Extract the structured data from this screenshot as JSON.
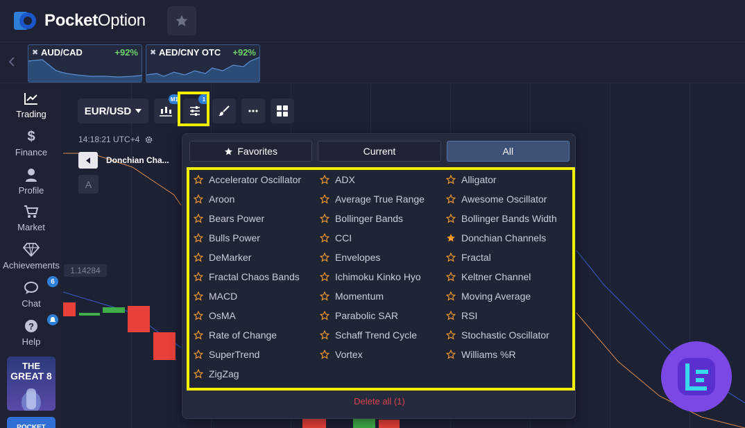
{
  "app": {
    "logo_bold": "Pocket",
    "logo_light": "Option"
  },
  "asset_tabs": [
    {
      "name": "AUD/CAD",
      "payout": "+92%"
    },
    {
      "name": "AED/CNY OTC",
      "payout": "+92%"
    }
  ],
  "sidebar": {
    "items": [
      {
        "label": "Trading",
        "icon": "chart-line-icon"
      },
      {
        "label": "Finance",
        "icon": "dollar-icon"
      },
      {
        "label": "Profile",
        "icon": "user-icon"
      },
      {
        "label": "Market",
        "icon": "cart-icon"
      },
      {
        "label": "Achievements",
        "icon": "diamond-icon"
      },
      {
        "label": "Chat",
        "icon": "chat-icon",
        "badge": "6"
      },
      {
        "label": "Help",
        "icon": "help-icon"
      }
    ],
    "promo": {
      "line1": "THE",
      "line2": "GREAT 8"
    },
    "promo2": "POCKET"
  },
  "toolbar": {
    "pair": "EUR/USD",
    "chart_type_badge": "M1",
    "indicators_badge": "1"
  },
  "chart": {
    "time": "14:18:21 UTC+4",
    "indicator_name": "Donchian Cha...",
    "a_label": "A",
    "price": "1.14284"
  },
  "panel": {
    "tabs": [
      {
        "label": "Favorites",
        "active": false
      },
      {
        "label": "Current",
        "active": false
      },
      {
        "label": "All",
        "active": true
      }
    ],
    "indicators": [
      {
        "name": "Accelerator Oscillator",
        "fav": false
      },
      {
        "name": "ADX",
        "fav": false
      },
      {
        "name": "Alligator",
        "fav": false
      },
      {
        "name": "Aroon",
        "fav": false
      },
      {
        "name": "Average True Range",
        "fav": false
      },
      {
        "name": "Awesome Oscillator",
        "fav": false
      },
      {
        "name": "Bears Power",
        "fav": false
      },
      {
        "name": "Bollinger Bands",
        "fav": false
      },
      {
        "name": "Bollinger Bands Width",
        "fav": false
      },
      {
        "name": "Bulls Power",
        "fav": false
      },
      {
        "name": "CCI",
        "fav": false
      },
      {
        "name": "Donchian Channels",
        "fav": true
      },
      {
        "name": "DeMarker",
        "fav": false
      },
      {
        "name": "Envelopes",
        "fav": false
      },
      {
        "name": "Fractal",
        "fav": false
      },
      {
        "name": "Fractal Chaos Bands",
        "fav": false
      },
      {
        "name": "Ichimoku Kinko Hyo",
        "fav": false
      },
      {
        "name": "Keltner Channel",
        "fav": false
      },
      {
        "name": "MACD",
        "fav": false
      },
      {
        "name": "Momentum",
        "fav": false
      },
      {
        "name": "Moving Average",
        "fav": false
      },
      {
        "name": "OsMA",
        "fav": false
      },
      {
        "name": "Parabolic SAR",
        "fav": false
      },
      {
        "name": "RSI",
        "fav": false
      },
      {
        "name": "Rate of Change",
        "fav": false
      },
      {
        "name": "Schaff Trend Cycle",
        "fav": false
      },
      {
        "name": "Stochastic Oscillator",
        "fav": false
      },
      {
        "name": "SuperTrend",
        "fav": false
      },
      {
        "name": "Vortex",
        "fav": false
      },
      {
        "name": "Williams %R",
        "fav": false
      },
      {
        "name": "ZigZag",
        "fav": false
      }
    ],
    "delete_all": "Delete all (1)"
  },
  "colors": {
    "accent_blue": "#2e7fd8",
    "highlight": "#f0f000",
    "star_orange": "#f39a2b",
    "up_green": "#3fae49",
    "down_red": "#e8413a",
    "payout_green": "#6fd16b"
  }
}
